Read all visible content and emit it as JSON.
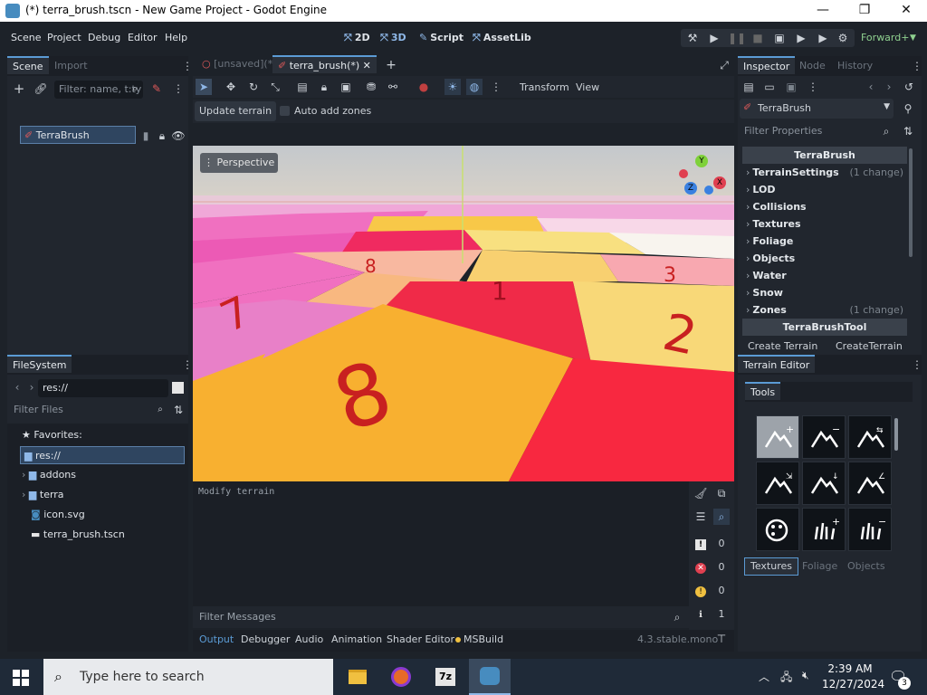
{
  "window": {
    "title": "(*) terra_brush.tscn - New Game Project - Godot Engine",
    "controls": [
      "—",
      "❐",
      "✕"
    ]
  },
  "menubar": {
    "items": [
      "Scene",
      "Project",
      "Debug",
      "Editor",
      "Help"
    ],
    "workspaces": [
      {
        "icon": "⬚",
        "label": "2D"
      },
      {
        "icon": "⬚",
        "label": "3D"
      },
      {
        "icon": "▤",
        "label": "Script"
      },
      {
        "icon": "⬚",
        "label": "AssetLib"
      }
    ],
    "renderer": "Forward+"
  },
  "scene_dock": {
    "tabs": [
      "Scene",
      "Import"
    ],
    "filter_placeholder": "Filter: name, t:ty",
    "root_node": "TerraBrush"
  },
  "filesystem_dock": {
    "tab": "FileSystem",
    "path": "res://",
    "filter_placeholder": "Filter Files",
    "favorites_label": "Favorites:",
    "items": [
      {
        "label": "res://",
        "type": "folder"
      },
      {
        "label": "addons",
        "type": "folder"
      },
      {
        "label": "terra",
        "type": "folder"
      },
      {
        "label": "icon.svg",
        "type": "file"
      },
      {
        "label": "terra_brush.tscn",
        "type": "scene"
      }
    ]
  },
  "editor_tabs": {
    "tabs": [
      {
        "label": "[unsaved](*)",
        "active": false
      },
      {
        "label": "terra_brush(*)",
        "active": true
      }
    ]
  },
  "viewport_toolbar": {
    "transform_label": "Transform",
    "view_label": "View",
    "update_terrain": "Update terrain",
    "auto_add_zones": "Auto add zones",
    "perspective": "Perspective"
  },
  "viewport": {
    "gizmo": {
      "y": "Y",
      "x": "X",
      "z": "Z"
    }
  },
  "output": {
    "text": "Modify terrain",
    "filter_placeholder": "Filter Messages",
    "counts": {
      "errors": "0",
      "warnings_red": "0",
      "warnings": "0",
      "info": "1",
      "messages": "0"
    }
  },
  "bottom_tabs": [
    "Output",
    "Debugger",
    "Audio",
    "Animation",
    "Shader Editor",
    "MSBuild"
  ],
  "version": "4.3.stable.mono",
  "inspector": {
    "tabs": [
      "Inspector",
      "Node",
      "History"
    ],
    "node_name": "TerraBrush",
    "filter_placeholder": "Filter Properties",
    "class_header": "TerraBrush",
    "sections": [
      {
        "label": "TerrainSettings",
        "change": "(1 change)"
      },
      {
        "label": "LOD",
        "change": ""
      },
      {
        "label": "Collisions",
        "change": ""
      },
      {
        "label": "Textures",
        "change": ""
      },
      {
        "label": "Foliage",
        "change": ""
      },
      {
        "label": "Objects",
        "change": ""
      },
      {
        "label": "Water",
        "change": ""
      },
      {
        "label": "Snow",
        "change": ""
      },
      {
        "label": "Zones",
        "change": "(1 change)"
      }
    ],
    "tool_header": "TerraBrushTool",
    "create_terrain_label": "Create Terrain",
    "create_terrain_value": "CreateTerrain"
  },
  "terrain_editor": {
    "title": "Terrain Editor",
    "tools_tab": "Tools",
    "tools": [
      "raise-icon",
      "lower-icon",
      "smooth-icon",
      "flatten-icon",
      "set-height-icon",
      "set-angle-icon",
      "paint-icon",
      "foliage-add-icon",
      "foliage-remove-icon"
    ],
    "bottom_tabs": [
      "Textures",
      "Foliage",
      "Objects"
    ]
  },
  "taskbar": {
    "search_placeholder": "Type here to search",
    "time": "2:39 AM",
    "date": "12/27/2024",
    "notification_count": "3"
  },
  "colors": {
    "accent": "#5b9bd5",
    "panel": "#21262e",
    "background": "#1d2229"
  }
}
